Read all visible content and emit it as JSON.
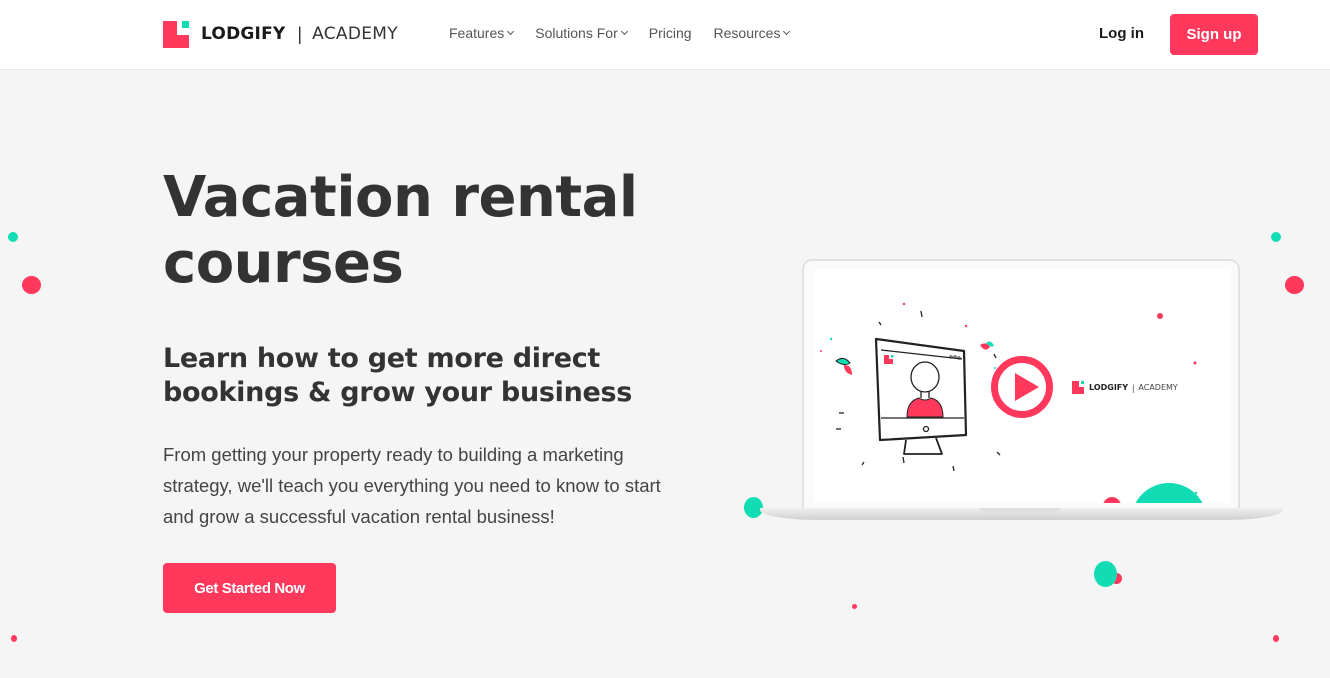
{
  "header": {
    "logo": {
      "brand": "LODGIFY",
      "separator": "|",
      "product": "ACADEMY"
    },
    "nav": [
      {
        "label": "Features",
        "has_dropdown": true
      },
      {
        "label": "Solutions For",
        "has_dropdown": true
      },
      {
        "label": "Pricing",
        "has_dropdown": false
      },
      {
        "label": "Resources",
        "has_dropdown": true
      }
    ],
    "login_label": "Log in",
    "signup_label": "Sign up"
  },
  "hero": {
    "title": "Vacation rental courses",
    "subtitle": "Learn how to get more direct bookings & grow your business",
    "description": "From getting your property ready to building a marketing strategy, we'll teach you everything you need to know to start and grow a successful vacation rental business!",
    "cta_label": "Get Started Now"
  },
  "video": {
    "logo_brand": "LODGIFY",
    "logo_separator": "|",
    "logo_product": "ACADEMY",
    "play_icon": "play-icon"
  },
  "colors": {
    "accent": "#ff385c",
    "secondary": "#12dcb4",
    "background": "#f5f5f5",
    "text": "#333333"
  }
}
